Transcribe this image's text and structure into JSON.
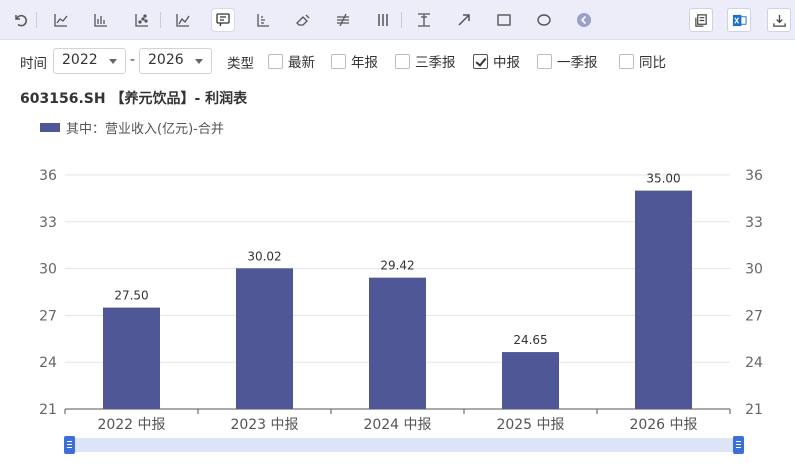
{
  "toolbar": {
    "left_icons": [
      "undo-icon",
      "line-chart-icon",
      "bar-chart-icon",
      "scatter-chart-icon",
      "trend-line-icon",
      "data-label-icon",
      "axis-icon",
      "eraser-icon",
      "strike-icon",
      "vertical-lines-icon",
      "text-box-icon",
      "arrow-draw-icon",
      "rectangle-draw-icon",
      "ellipse-draw-icon",
      "collapse-icon"
    ],
    "right_icons": [
      "copy-icon",
      "excel-export-icon",
      "download-icon"
    ]
  },
  "filter": {
    "time_label": "时间",
    "start_year": "2022",
    "separator": "-",
    "end_year": "2026",
    "type_label": "类型",
    "options": [
      {
        "label": "最新",
        "checked": false
      },
      {
        "label": "年报",
        "checked": false
      },
      {
        "label": "三季报",
        "checked": false
      },
      {
        "label": "中报",
        "checked": true
      },
      {
        "label": "一季报",
        "checked": false
      },
      {
        "label": "同比",
        "checked": false
      }
    ]
  },
  "chart_title": "603156.SH 【养元饮品】- 利润表",
  "colors": {
    "bar": "#4f5797",
    "toolbar_bg": "#ecedf8",
    "slider": "#3b6fd8",
    "slider_track": "#dde4f7"
  },
  "chart_data": {
    "type": "bar",
    "categories": [
      "2022 中报",
      "2023 中报",
      "2024 中报",
      "2025 中报",
      "2026 中报"
    ],
    "series": [
      {
        "name": "其中：营业收入(亿元)-合并",
        "values": [
          27.5,
          30.02,
          29.42,
          24.65,
          35.0
        ]
      }
    ],
    "data_labels": [
      "27.50",
      "30.02",
      "29.42",
      "24.65",
      "35.00"
    ],
    "ylim": [
      21,
      36
    ],
    "yticks": [
      21,
      24,
      27,
      30,
      33,
      36
    ],
    "ytick_labels": [
      "21",
      "24",
      "27",
      "30",
      "33",
      "36"
    ],
    "dual_y_axis": true,
    "grid": true,
    "legend": "top-left"
  }
}
